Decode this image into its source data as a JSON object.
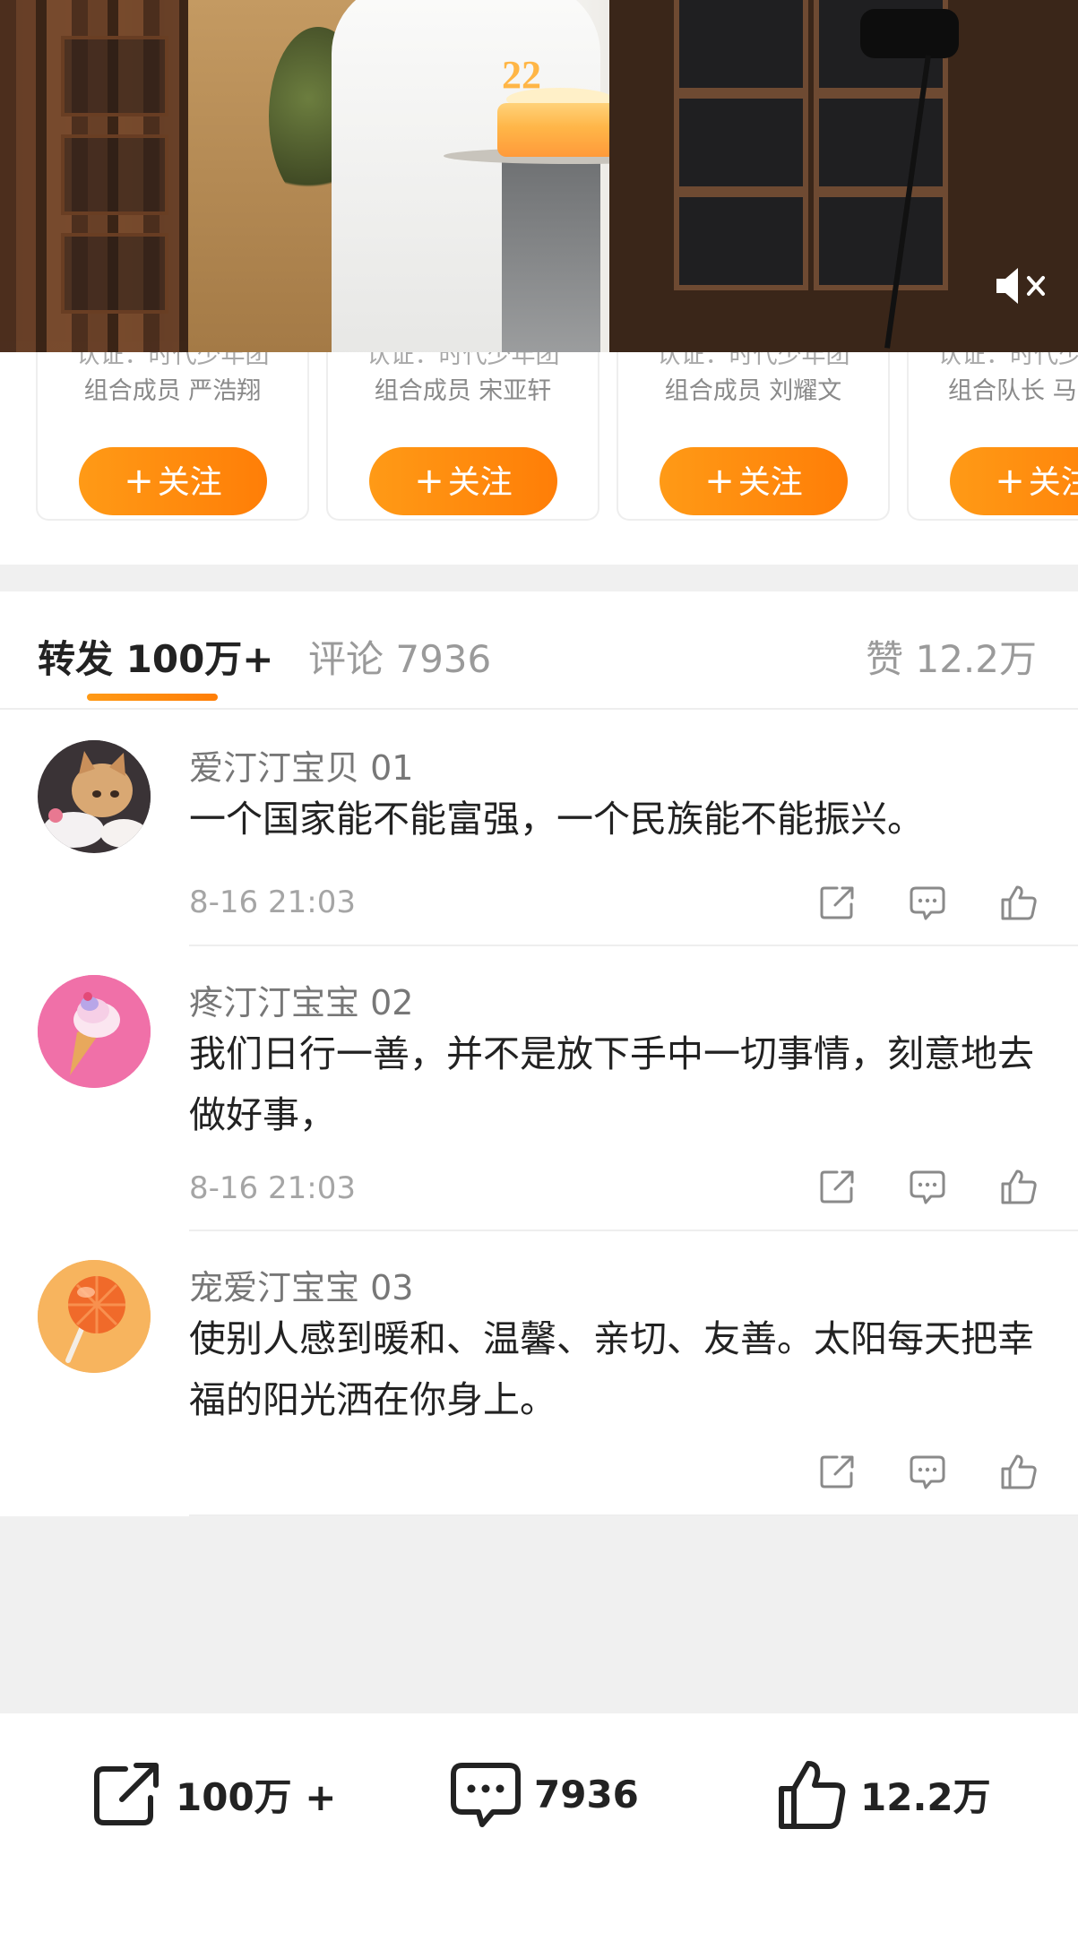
{
  "creators": [
    {
      "cert_line1": "认证：时代少年团",
      "cert_line2": "组合成员 严浩翔",
      "follow_label": "关注"
    },
    {
      "cert_line1": "认证：时代少年团",
      "cert_line2": "组合成员 宋亚轩",
      "follow_label": "关注"
    },
    {
      "cert_line1": "认证：时代少年团",
      "cert_line2": "组合成员 刘耀文",
      "follow_label": "关注"
    },
    {
      "cert_line1": "认证：时代少",
      "cert_line2": "组合队长 马",
      "follow_label": "关注"
    }
  ],
  "video": {
    "cake_number": "22"
  },
  "tabs": {
    "reposts_label": "转发 100万+",
    "comments_label": "评论 7936",
    "likes_label": "赞 12.2万"
  },
  "comments": [
    {
      "name": "爱汀汀宝贝 01",
      "text": "一个国家能不能富强，一个民族能不能振兴。",
      "time": "8-16 21:03"
    },
    {
      "name": "疼汀汀宝宝 02",
      "text": "我们日行一善，并不是放下手中一切事情，刻意地去做好事，",
      "time": "8-16 21:03"
    },
    {
      "name": "宠爱汀宝宝 03",
      "text": "使别人感到暖和、温馨、亲切、友善。太阳每天把幸福的阳光洒在你身上。",
      "time": ""
    }
  ],
  "bottom_bar": {
    "repost_count": "100万 +",
    "comment_count": "7936",
    "like_count": "12.2万"
  },
  "colors": {
    "accent": "#ff8a0e",
    "divider": "#eeeeee",
    "band": "#f0f0f0"
  }
}
